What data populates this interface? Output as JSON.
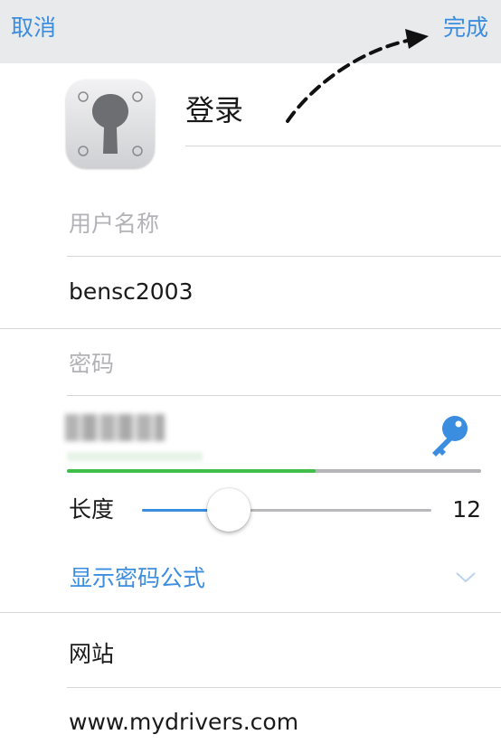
{
  "nav": {
    "cancel_label": "取消",
    "done_label": "完成"
  },
  "item": {
    "title": "登录"
  },
  "username": {
    "label": "用户名称",
    "value": "bensc2003"
  },
  "password": {
    "label": "密码",
    "strength": 0.6
  },
  "length": {
    "label": "长度",
    "value": "12",
    "slider_fraction": 0.3
  },
  "formula": {
    "label": "显示密码公式"
  },
  "website": {
    "label": "网站",
    "value": "www.mydrivers.com"
  },
  "colors": {
    "accent": "#3b8de0",
    "strength_good": "#3fbf4a",
    "nav_bg": "#e9eaec"
  }
}
